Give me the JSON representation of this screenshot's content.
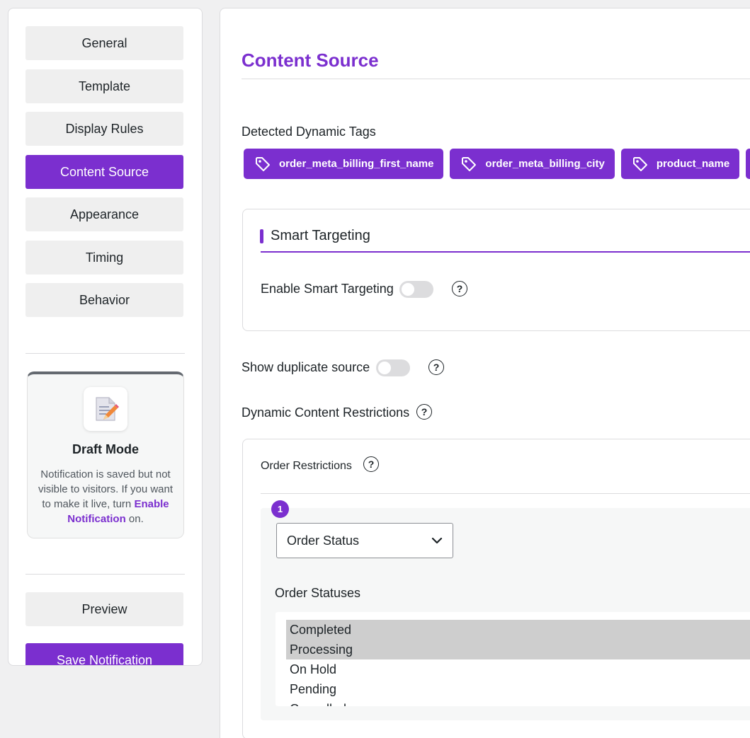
{
  "sidebar": {
    "items": [
      {
        "label": "General"
      },
      {
        "label": "Template"
      },
      {
        "label": "Display Rules"
      },
      {
        "label": "Content Source",
        "active": true
      },
      {
        "label": "Appearance"
      },
      {
        "label": "Timing"
      },
      {
        "label": "Behavior"
      }
    ],
    "draft": {
      "title": "Draft Mode",
      "text_before": "Notification is saved but not visible to visitors. If you want to make it live, turn ",
      "link": "Enable Notification",
      "text_after": " on."
    },
    "preview_label": "Preview",
    "save_label": "Save Notification"
  },
  "main": {
    "title": "Content Source",
    "detected_tags_label": "Detected Dynamic Tags",
    "tags": [
      "order_meta_billing_first_name",
      "order_meta_billing_city",
      "product_name",
      ""
    ],
    "smart_targeting": {
      "title": "Smart Targeting",
      "enable_label": "Enable Smart Targeting",
      "enabled": false
    },
    "duplicate": {
      "label": "Show duplicate source",
      "enabled": false
    },
    "restrictions": {
      "label": "Dynamic Content Restrictions",
      "order_restrictions_label": "Order Restrictions",
      "rule_number": "1",
      "select_value": "Order Status",
      "statuses_label": "Order Statuses",
      "statuses": [
        {
          "label": "Completed",
          "selected": true
        },
        {
          "label": "Processing",
          "selected": true
        },
        {
          "label": "On Hold",
          "selected": false
        },
        {
          "label": "Pending",
          "selected": false
        },
        {
          "label": "Cancelled",
          "selected": false
        }
      ]
    },
    "help_glyph": "?"
  },
  "colors": {
    "accent": "#7b2fcf",
    "nav_bg": "#efefef",
    "selected_option": "#cecece"
  }
}
